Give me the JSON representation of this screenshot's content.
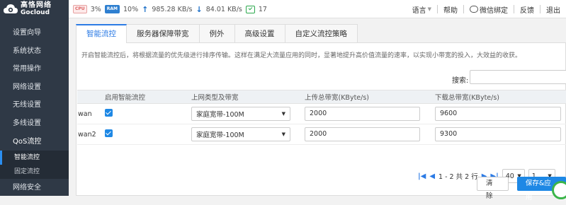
{
  "brand": {
    "name_cn": "高恪网络",
    "name_en": "Gocloud"
  },
  "status": {
    "cpu_chip": "CPU",
    "cpu": "3%",
    "ram_chip": "RAM",
    "ram": "10%",
    "upload": "985.28 KB/s",
    "download": "84.01 KB/s",
    "messages": "17"
  },
  "topnav": {
    "language": "语言",
    "help": "帮助",
    "wechat": "微信绑定",
    "feedback": "反馈",
    "logout": "退出"
  },
  "sidebar": {
    "items": [
      "设置向导",
      "系统状态",
      "常用操作",
      "网络设置",
      "无线设置",
      "多线设置",
      "QoS流控"
    ],
    "sub_items": [
      "智能流控",
      "固定流控"
    ],
    "next_item": "网络安全"
  },
  "tabs": [
    "智能流控",
    "服务器保障带宽",
    "例外",
    "高级设置",
    "自定义流控策略"
  ],
  "info_text": "开启智能流控后，将根据流量的优先级进行排序传输。这样在满足大流量应用的同时，显著地提升高价值流量的速率，以实现小带宽的投入，大效益的收获。",
  "search": {
    "label": "搜索:",
    "value": ""
  },
  "table": {
    "headers": [
      "",
      "启用智能流控",
      "上网类型及带宽",
      "上传总带宽(KByte/s)",
      "下载总带宽(KByte/s)"
    ],
    "rows": [
      {
        "name": "wan",
        "enabled": true,
        "type": "家庭宽带-100M",
        "upload": "2000",
        "download": "9600"
      },
      {
        "name": "wan2",
        "enabled": true,
        "type": "家庭宽带-100M",
        "upload": "2000",
        "download": "9300"
      }
    ]
  },
  "pagination": {
    "info": "1 - 2 共 2 行",
    "page_size": "40",
    "page": "1"
  },
  "buttons": {
    "clear": "清除",
    "save": "保存&应用"
  },
  "colors": {
    "accent": "#2c7be5",
    "sidebar_bg": "#2f3946",
    "save_btn": "#1e88e5"
  }
}
